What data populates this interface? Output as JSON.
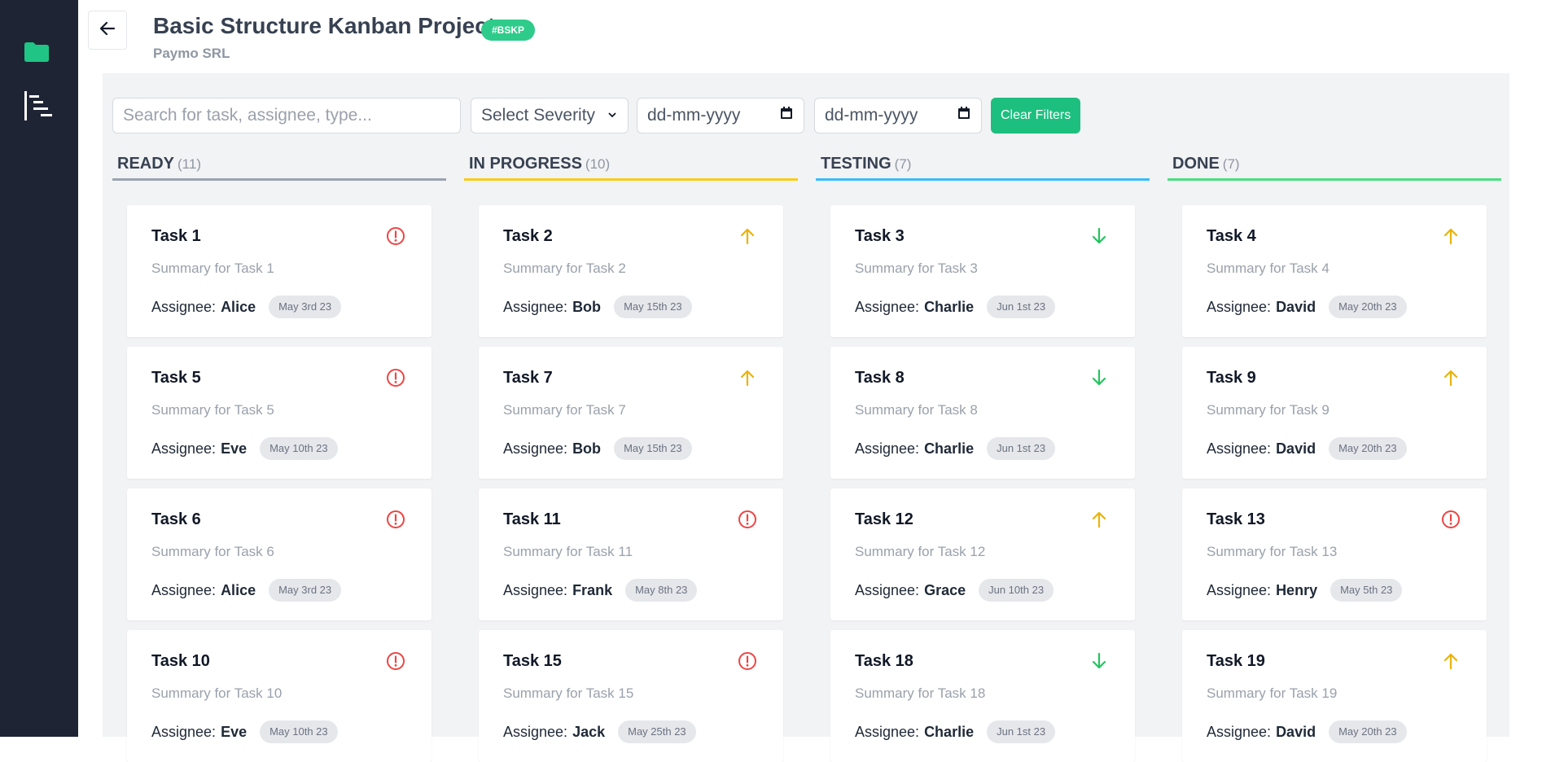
{
  "header": {
    "title": "Basic Structure Kanban Project",
    "badge": "#BSKP",
    "company": "Paymo SRL"
  },
  "sidebar": {
    "items": [
      {
        "icon": "folder-icon",
        "color": "#20c485"
      },
      {
        "icon": "gantt-icon",
        "color": "#ffffff"
      }
    ]
  },
  "filters": {
    "search_placeholder": "Search for task, assignee, type...",
    "severity_label": "Select Severity",
    "date_from_placeholder": "dd-mm-yyyy",
    "date_to_placeholder": "dd-mm-yyyy",
    "clear_label": "Clear Filters"
  },
  "labels": {
    "assignee": "Assignee:"
  },
  "colors": {
    "ready": "#9ca3af",
    "in_progress": "#facc15",
    "testing": "#38bdf8",
    "done": "#4ade80",
    "severity_high": "#ef4444",
    "severity_medium": "#eab308",
    "severity_low": "#22c55e",
    "accent": "#1dbf7e"
  },
  "columns": [
    {
      "title": "READY",
      "count": "(11)",
      "cards": [
        {
          "title": "Task 1",
          "summary": "Summary for Task 1",
          "assignee": "Alice",
          "date": "May 3rd 23",
          "severity": "alert-circle-icon"
        },
        {
          "title": "Task 5",
          "summary": "Summary for Task 5",
          "assignee": "Eve",
          "date": "May 10th 23",
          "severity": "alert-circle-icon"
        },
        {
          "title": "Task 6",
          "summary": "Summary for Task 6",
          "assignee": "Alice",
          "date": "May 3rd 23",
          "severity": "alert-circle-icon"
        },
        {
          "title": "Task 10",
          "summary": "Summary for Task 10",
          "assignee": "Eve",
          "date": "May 10th 23",
          "severity": "alert-circle-icon"
        }
      ]
    },
    {
      "title": "IN PROGRESS",
      "count": "(10)",
      "cards": [
        {
          "title": "Task 2",
          "summary": "Summary for Task 2",
          "assignee": "Bob",
          "date": "May 15th 23",
          "severity": "arrow-up-icon"
        },
        {
          "title": "Task 7",
          "summary": "Summary for Task 7",
          "assignee": "Bob",
          "date": "May 15th 23",
          "severity": "arrow-up-icon"
        },
        {
          "title": "Task 11",
          "summary": "Summary for Task 11",
          "assignee": "Frank",
          "date": "May 8th 23",
          "severity": "alert-circle-icon"
        },
        {
          "title": "Task 15",
          "summary": "Summary for Task 15",
          "assignee": "Jack",
          "date": "May 25th 23",
          "severity": "alert-circle-icon"
        }
      ]
    },
    {
      "title": "TESTING",
      "count": "(7)",
      "cards": [
        {
          "title": "Task 3",
          "summary": "Summary for Task 3",
          "assignee": "Charlie",
          "date": "Jun 1st 23",
          "severity": "arrow-down-icon"
        },
        {
          "title": "Task 8",
          "summary": "Summary for Task 8",
          "assignee": "Charlie",
          "date": "Jun 1st 23",
          "severity": "arrow-down-icon"
        },
        {
          "title": "Task 12",
          "summary": "Summary for Task 12",
          "assignee": "Grace",
          "date": "Jun 10th 23",
          "severity": "arrow-up-icon"
        },
        {
          "title": "Task 18",
          "summary": "Summary for Task 18",
          "assignee": "Charlie",
          "date": "Jun 1st 23",
          "severity": "arrow-down-icon"
        }
      ]
    },
    {
      "title": "DONE",
      "count": "(7)",
      "cards": [
        {
          "title": "Task 4",
          "summary": "Summary for Task 4",
          "assignee": "David",
          "date": "May 20th 23",
          "severity": "arrow-up-icon"
        },
        {
          "title": "Task 9",
          "summary": "Summary for Task 9",
          "assignee": "David",
          "date": "May 20th 23",
          "severity": "arrow-up-icon"
        },
        {
          "title": "Task 13",
          "summary": "Summary for Task 13",
          "assignee": "Henry",
          "date": "May 5th 23",
          "severity": "alert-circle-icon"
        },
        {
          "title": "Task 19",
          "summary": "Summary for Task 19",
          "assignee": "David",
          "date": "May 20th 23",
          "severity": "arrow-up-icon"
        }
      ]
    }
  ]
}
